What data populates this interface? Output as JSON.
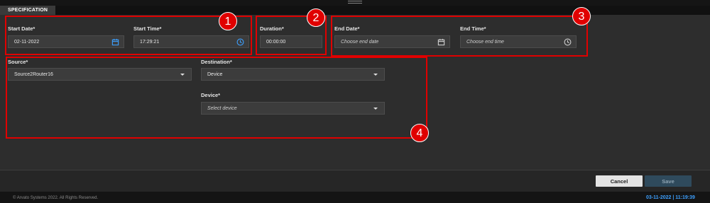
{
  "tab": {
    "label": "SPECIFICATION"
  },
  "start": {
    "date_label": "Start Date*",
    "date_value": "02-11-2022",
    "time_label": "Start Time*",
    "time_value": "17:29:21"
  },
  "duration": {
    "label": "Duration*",
    "value": "00:00:00"
  },
  "end": {
    "date_label": "End Date*",
    "date_placeholder": "Choose end date",
    "time_label": "End Time*",
    "time_placeholder": "Choose end time"
  },
  "routing": {
    "source_label": "Source*",
    "source_value": "Source2Router16",
    "destination_label": "Destination*",
    "destination_value": "Device",
    "device_label": "Device*",
    "device_placeholder": "Select device"
  },
  "annotations": {
    "badges": [
      "1",
      "2",
      "3",
      "4"
    ],
    "color": "#e00000"
  },
  "actions": {
    "cancel_label": "Cancel",
    "save_label": "Save"
  },
  "footer": {
    "copyright": "© Arvato Systems 2022. All Rights Reserved.",
    "clock": "03-11-2022 | 11:19:39"
  },
  "icons": {
    "start_date": "calendar-icon",
    "start_time": "clock-icon",
    "end_date": "calendar-icon",
    "end_time": "clock-icon",
    "dropdown": "chevron-down-icon"
  },
  "colors": {
    "accent": "#3da0ff",
    "background": "#2d2d2d"
  }
}
